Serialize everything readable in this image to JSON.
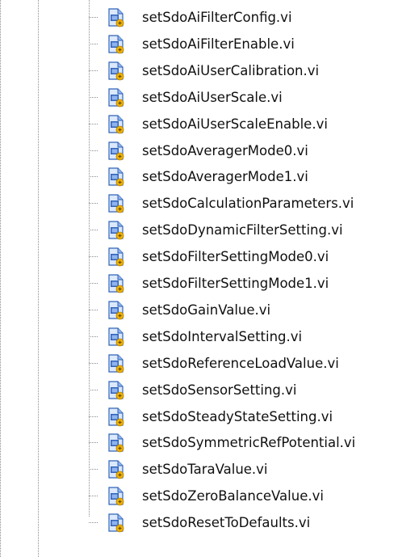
{
  "tree": {
    "items": [
      {
        "label": "setSdoAiFilterConfig.vi",
        "icon": "vi-file-icon"
      },
      {
        "label": "setSdoAiFilterEnable.vi",
        "icon": "vi-file-icon"
      },
      {
        "label": "setSdoAiUserCalibration.vi",
        "icon": "vi-file-icon"
      },
      {
        "label": "setSdoAiUserScale.vi",
        "icon": "vi-file-icon"
      },
      {
        "label": "setSdoAiUserScaleEnable.vi",
        "icon": "vi-file-icon"
      },
      {
        "label": "setSdoAveragerMode0.vi",
        "icon": "vi-file-icon"
      },
      {
        "label": "setSdoAveragerMode1.vi",
        "icon": "vi-file-icon"
      },
      {
        "label": "setSdoCalculationParameters.vi",
        "icon": "vi-file-icon"
      },
      {
        "label": "setSdoDynamicFilterSetting.vi",
        "icon": "vi-file-icon"
      },
      {
        "label": "setSdoFilterSettingMode0.vi",
        "icon": "vi-file-icon"
      },
      {
        "label": "setSdoFilterSettingMode1.vi",
        "icon": "vi-file-icon"
      },
      {
        "label": "setSdoGainValue.vi",
        "icon": "vi-file-icon"
      },
      {
        "label": "setSdoIntervalSetting.vi",
        "icon": "vi-file-icon"
      },
      {
        "label": "setSdoReferenceLoadValue.vi",
        "icon": "vi-file-icon"
      },
      {
        "label": "setSdoSensorSetting.vi",
        "icon": "vi-file-icon"
      },
      {
        "label": "setSdoSteadyStateSetting.vi",
        "icon": "vi-file-icon"
      },
      {
        "label": "setSdoSymmetricRefPotential.vi",
        "icon": "vi-file-icon"
      },
      {
        "label": "setSdoTaraValue.vi",
        "icon": "vi-file-icon"
      },
      {
        "label": "setSdoZeroBalanceValue.vi",
        "icon": "vi-file-icon"
      },
      {
        "label": "setSdoResetToDefaults.vi",
        "icon": "vi-file-icon"
      }
    ]
  },
  "colors": {
    "icon_blue": "#2f63b8",
    "icon_blue_light": "#8fb3ee",
    "icon_badge": "#f0b400",
    "tree_line": "#8c8c8c"
  }
}
